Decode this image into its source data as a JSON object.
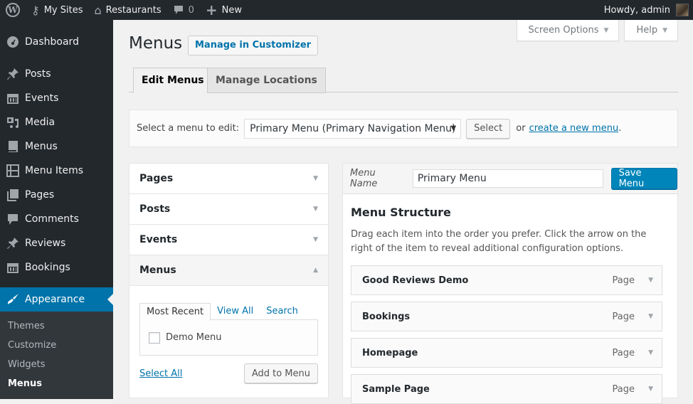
{
  "adminbar": {
    "wp_logo": "wordpress-logo-icon",
    "my_sites": "My Sites",
    "site_name": "Restaurants",
    "comments_count": "0",
    "new_label": "New",
    "greeting": "Howdy, admin"
  },
  "sidebar": {
    "items": [
      {
        "label": "Dashboard",
        "icon": "dashboard-icon"
      },
      {
        "label": "Posts",
        "icon": "pin-icon"
      },
      {
        "label": "Events",
        "icon": "calendar-icon"
      },
      {
        "label": "Media",
        "icon": "media-icon"
      },
      {
        "label": "Menus",
        "icon": "book-icon"
      },
      {
        "label": "Menu Items",
        "icon": "table-icon"
      },
      {
        "label": "Pages",
        "icon": "pages-icon"
      },
      {
        "label": "Comments",
        "icon": "comment-icon"
      },
      {
        "label": "Reviews",
        "icon": "pin-icon"
      },
      {
        "label": "Bookings",
        "icon": "calendar-icon"
      },
      {
        "label": "Appearance",
        "icon": "paintbrush-icon"
      }
    ],
    "submenu": [
      "Themes",
      "Customize",
      "Widgets",
      "Menus"
    ]
  },
  "screen_meta": {
    "screen_options": "Screen Options",
    "help": "Help"
  },
  "page": {
    "title": "Menus",
    "customizer_button": "Manage in Customizer",
    "tabs": [
      "Edit Menus",
      "Manage Locations"
    ]
  },
  "menu_select": {
    "label": "Select a menu to edit:",
    "selected": "Primary Menu (Primary Navigation Menu)",
    "select_button": "Select",
    "or_text": "or",
    "create_link": "create a new menu",
    "period": "."
  },
  "accordion": {
    "sections": [
      "Pages",
      "Posts",
      "Events",
      "Menus"
    ],
    "open_section": "Menus",
    "subtabs": [
      "Most Recent",
      "View All",
      "Search"
    ],
    "items": [
      {
        "label": "Demo Menu",
        "checked": false
      }
    ],
    "select_all": "Select All",
    "add_button": "Add to Menu"
  },
  "management": {
    "menu_name_label": "Menu Name",
    "menu_name_value": "Primary Menu",
    "save_button": "Save Menu",
    "structure_title": "Menu Structure",
    "instructions": "Drag each item into the order you prefer. Click the arrow on the right of the item to reveal additional configuration options.",
    "items": [
      {
        "title": "Good Reviews Demo",
        "type": "Page"
      },
      {
        "title": "Bookings",
        "type": "Page"
      },
      {
        "title": "Homepage",
        "type": "Page"
      },
      {
        "title": "Sample Page",
        "type": "Page"
      }
    ]
  }
}
